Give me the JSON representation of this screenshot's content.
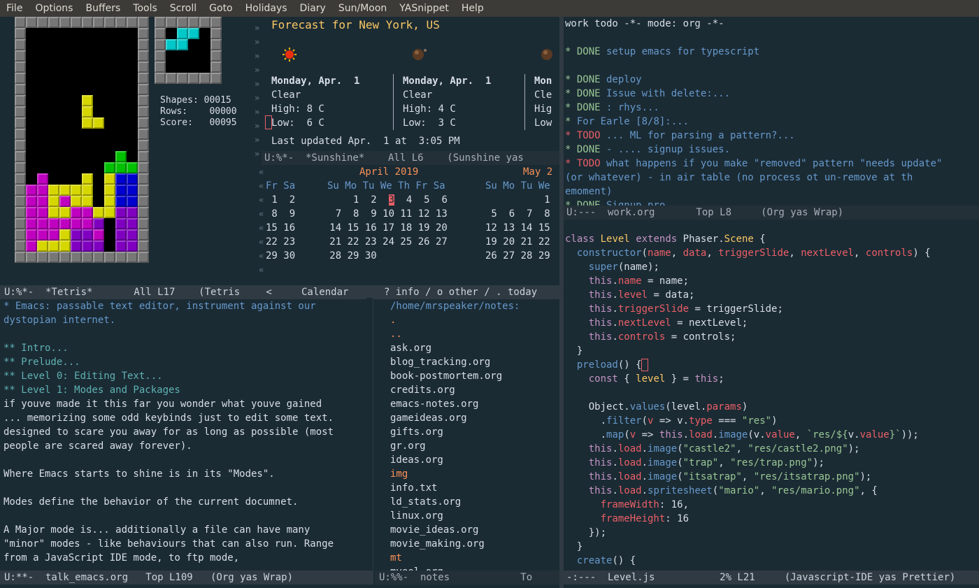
{
  "menu": [
    "File",
    "Options",
    "Buffers",
    "Tools",
    "Scroll",
    "Goto",
    "Holidays",
    "Diary",
    "Sun/Moon",
    "YASnippet",
    "Help"
  ],
  "tetris": {
    "shapes_label": "Shapes:",
    "shapes": "00015",
    "rows_label": "Rows:",
    "rows": "00000",
    "score_label": "Score:",
    "score": "00095",
    "modeline": "U:%*-  *Tetris*       All L17    (Tetris"
  },
  "sunshine": {
    "title": "Forecast for New York, US",
    "days": [
      {
        "date": "Monday, Apr.  1",
        "desc": "Clear",
        "high": "High: 8 C",
        "low": "Low:  6 C"
      },
      {
        "date": "Monday, Apr.  1",
        "desc": "Clear",
        "high": "High: 4 C",
        "low": "Low:  3 C"
      },
      {
        "date": "Mon",
        "desc": "Cle",
        "high": "Hig",
        "low": "Low"
      }
    ],
    "updated": "Last updated Apr.  1 at  3:05 PM",
    "modeline": "U:%*-  *Sunshine*    All L6    (Sunshine yas"
  },
  "calendar": {
    "month1": "April 2019",
    "month2": "May 2",
    "prev_header": "Fr Sa",
    "header": "Su Mo Tu We Th Fr Sa",
    "header2": "Su Mo Tu We",
    "prev_rows": [
      " 1  2",
      " 8  9",
      "15 16",
      "22 23",
      "29 30"
    ],
    "rows": [
      "       1  2  3  4  5  6",
      "    7  8  9 10 11 12 13",
      "   14 15 16 17 18 19 20",
      "   21 22 23 24 25 26 27",
      "   28 29 30"
    ],
    "rows2": [
      "          1",
      " 5  6  7  8",
      "12 13 14 15",
      "19 20 21 22",
      "26 27 28 29"
    ],
    "today": "3",
    "modeline": " <     Calendar      ? info / o other / . today"
  },
  "talk": {
    "lines": [
      {
        "t": "* Emacs: passable text editor, instrument against our",
        "c": "org1"
      },
      {
        "t": "dystopian internet.",
        "c": "org1"
      },
      {
        "t": "",
        "c": "w"
      },
      {
        "t": "** Intro...",
        "c": "org2"
      },
      {
        "t": "** Prelude...",
        "c": "org2"
      },
      {
        "t": "** Level 0: Editing Text...",
        "c": "org2"
      },
      {
        "t": "** Level 1: Modes and Packages",
        "c": "org2"
      },
      {
        "t": "if youve made it this far you wonder what youve gained",
        "c": "w"
      },
      {
        "t": "... memorizing some odd keybinds just to edit some text.",
        "c": "w"
      },
      {
        "t": "designed to scare you away for as long as possible (most",
        "c": "w"
      },
      {
        "t": "people are scared away forever).",
        "c": "w"
      },
      {
        "t": "",
        "c": "w"
      },
      {
        "t": "Where Emacs starts to shine is in its \"Modes\".",
        "c": "w"
      },
      {
        "t": "",
        "c": "w"
      },
      {
        "t": "Modes define the behavior of the current documnet.",
        "c": "w"
      },
      {
        "t": "",
        "c": "w"
      },
      {
        "t": "A Major mode is... additionally a file can have many",
        "c": "w"
      },
      {
        "t": "\"minor\" modes - like behaviours that can also run. Range",
        "c": "w"
      },
      {
        "t": "from a JavaScript IDE mode, to ftp mode,",
        "c": "w"
      }
    ],
    "modeline": "U:**-  talk_emacs.org   Top L109   (Org yas Wrap)"
  },
  "dired": {
    "header": "/home/mrspeaker/notes:",
    "files": [
      ".",
      "..",
      "ask.org",
      "blog_tracking.org",
      "book-postmortem.org",
      "credits.org",
      "emacs-notes.org",
      "gameideas.org",
      "gifts.org",
      "gr.org",
      "ideas.org",
      "img",
      "info.txt",
      "ld_stats.org",
      "linux.org",
      "movie_ideas.org",
      "movie_making.org",
      "mt",
      "myeel.org"
    ],
    "modeline": "U:%%-  notes            To"
  },
  "work": {
    "lines": [
      {
        "t": "work todo -*- mode: org -*-",
        "c": "w"
      },
      {
        "t": "",
        "c": "w"
      },
      {
        "k": "* DONE",
        "t": " setup emacs for typescript",
        "c": "done"
      },
      {
        "t": "",
        "c": "w"
      },
      {
        "k": "* DONE",
        "t": " deploy",
        "c": "done"
      },
      {
        "k": "* DONE",
        "t": " Issue with delete:...",
        "c": "done"
      },
      {
        "k": "* DONE",
        "t": " : rhys...",
        "c": "done"
      },
      {
        "k": "*",
        "t": " For Earle [8/8]:...",
        "c": "done"
      },
      {
        "k": "* TODO",
        "t": " ... ML for parsing a pattern?...",
        "c": "todo"
      },
      {
        "k": "* DONE",
        "t": " - .... signup issues.",
        "c": "done"
      },
      {
        "k": "* TODO",
        "t": " what happens if you make \"removed\" pattern \"needs update\"",
        "c": "todo"
      },
      {
        "t": "(or whatever) - in air table (no process ot un-remove at th",
        "c": "org1"
      },
      {
        "t": "emoment)",
        "c": "org1"
      },
      {
        "k": "* DONE",
        "t": " Signup pro",
        "c": "done"
      }
    ],
    "modeline": "U:---  work.org       Top L8     (Org yas Wrap)"
  },
  "code": {
    "modeline": "-:---  Level.js           2% L21     (Javascript-IDE yas Prettier)"
  },
  "colors": {
    "bg": "#1b2b34",
    "modeline": "#2f3a42",
    "menubar": "#3c3b37"
  }
}
